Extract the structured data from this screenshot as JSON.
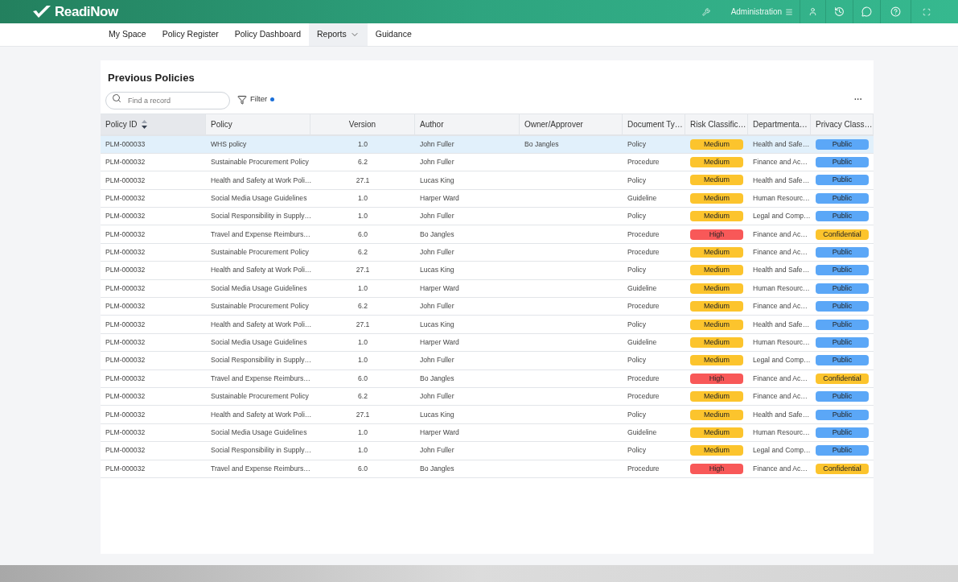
{
  "app": {
    "logo": "ReadiNow",
    "admin_label": "Administration"
  },
  "nav": [
    {
      "label": "My Space",
      "selected": false,
      "dropdown": false
    },
    {
      "label": "Policy Register",
      "selected": false,
      "dropdown": false
    },
    {
      "label": "Policy Dashboard",
      "selected": false,
      "dropdown": false
    },
    {
      "label": "Reports",
      "selected": true,
      "dropdown": true
    },
    {
      "label": "Guidance",
      "selected": false,
      "dropdown": false
    }
  ],
  "report": {
    "title": "Previous Policies",
    "search": {
      "placeholder": "Find a record"
    },
    "filter": {
      "label": "Filter",
      "active": true
    },
    "more": "···"
  },
  "table": {
    "columns": [
      {
        "label": "Policy ID",
        "sorted": true
      },
      {
        "label": "Policy",
        "sorted": false
      },
      {
        "label": "Version",
        "sorted": false
      },
      {
        "label": "Author",
        "sorted": false
      },
      {
        "label": "Owner/Approver",
        "sorted": false
      },
      {
        "label": "Document Ty…",
        "sorted": false
      },
      {
        "label": "Risk Classific…",
        "sorted": false
      },
      {
        "label": "Departmenta…",
        "sorted": false
      },
      {
        "label": "Privacy Class…",
        "sorted": false
      }
    ],
    "rows": [
      {
        "selected": true,
        "id": "PLM-000033",
        "policy": "WHS policy",
        "version": "1.0",
        "author": "John Fuller",
        "owner": "Bo Jangles",
        "doc_type": "Policy",
        "risk": {
          "text": "Medium",
          "color": "#fcc42d"
        },
        "department": "Health and Safe…",
        "privacy": {
          "text": "Public",
          "color": "#5ba7f7"
        }
      },
      {
        "selected": false,
        "id": "PLM-000032",
        "policy": "Sustainable Procurement Policy",
        "version": "6.2",
        "author": "John Fuller",
        "doc_type": "Procedure",
        "risk": {
          "text": "Medium",
          "color": "#fcc42d"
        },
        "department": "Finance and Ac…",
        "privacy": {
          "text": "Public",
          "color": "#5ba7f7"
        }
      },
      {
        "selected": false,
        "id": "PLM-000032",
        "policy": "Health and Safety at Work Poli…",
        "version": "27.1",
        "author": "Lucas King",
        "doc_type": "Policy",
        "risk": {
          "text": "Medium",
          "color": "#fcc42d"
        },
        "department": "Health and Safe…",
        "privacy": {
          "text": "Public",
          "color": "#5ba7f7"
        }
      },
      {
        "selected": false,
        "id": "PLM-000032",
        "policy": "Social Media Usage Guidelines",
        "version": "1.0",
        "author": "Harper Ward",
        "doc_type": "Guideline",
        "risk": {
          "text": "Medium",
          "color": "#fcc42d"
        },
        "department": "Human Resourc…",
        "privacy": {
          "text": "Public",
          "color": "#5ba7f7"
        }
      },
      {
        "selected": false,
        "id": "PLM-000032",
        "policy": "Social Responsibility in Supply…",
        "version": "1.0",
        "author": "John Fuller",
        "doc_type": "Policy",
        "risk": {
          "text": "Medium",
          "color": "#fcc42d"
        },
        "department": "Legal and Comp…",
        "privacy": {
          "text": "Public",
          "color": "#5ba7f7"
        }
      },
      {
        "selected": false,
        "id": "PLM-000032",
        "policy": "Travel and Expense Reimburs…",
        "version": "6.0",
        "author": "Bo Jangles",
        "doc_type": "Procedure",
        "risk": {
          "text": "High",
          "color": "#f85858"
        },
        "department": "Finance and Ac…",
        "privacy": {
          "text": "Confidential",
          "color": "#fcc42d"
        }
      },
      {
        "selected": false,
        "id": "PLM-000032",
        "policy": "Sustainable Procurement Policy",
        "version": "6.2",
        "author": "John Fuller",
        "doc_type": "Procedure",
        "risk": {
          "text": "Medium",
          "color": "#fcc42d"
        },
        "department": "Finance and Ac…",
        "privacy": {
          "text": "Public",
          "color": "#5ba7f7"
        }
      },
      {
        "selected": false,
        "id": "PLM-000032",
        "policy": "Health and Safety at Work Poli…",
        "version": "27.1",
        "author": "Lucas King",
        "doc_type": "Policy",
        "risk": {
          "text": "Medium",
          "color": "#fcc42d"
        },
        "department": "Health and Safe…",
        "privacy": {
          "text": "Public",
          "color": "#5ba7f7"
        }
      },
      {
        "selected": false,
        "id": "PLM-000032",
        "policy": "Social Media Usage Guidelines",
        "version": "1.0",
        "author": "Harper Ward",
        "doc_type": "Guideline",
        "risk": {
          "text": "Medium",
          "color": "#fcc42d"
        },
        "department": "Human Resourc…",
        "privacy": {
          "text": "Public",
          "color": "#5ba7f7"
        }
      },
      {
        "selected": false,
        "id": "PLM-000032",
        "policy": "Sustainable Procurement Policy",
        "version": "6.2",
        "author": "John Fuller",
        "doc_type": "Procedure",
        "risk": {
          "text": "Medium",
          "color": "#fcc42d"
        },
        "department": "Finance and Ac…",
        "privacy": {
          "text": "Public",
          "color": "#5ba7f7"
        }
      },
      {
        "selected": false,
        "id": "PLM-000032",
        "policy": "Health and Safety at Work Poli…",
        "version": "27.1",
        "author": "Lucas King",
        "doc_type": "Policy",
        "risk": {
          "text": "Medium",
          "color": "#fcc42d"
        },
        "department": "Health and Safe…",
        "privacy": {
          "text": "Public",
          "color": "#5ba7f7"
        }
      },
      {
        "selected": false,
        "id": "PLM-000032",
        "policy": "Social Media Usage Guidelines",
        "version": "1.0",
        "author": "Harper Ward",
        "doc_type": "Guideline",
        "risk": {
          "text": "Medium",
          "color": "#fcc42d"
        },
        "department": "Human Resourc…",
        "privacy": {
          "text": "Public",
          "color": "#5ba7f7"
        }
      },
      {
        "selected": false,
        "id": "PLM-000032",
        "policy": "Social Responsibility in Supply…",
        "version": "1.0",
        "author": "John Fuller",
        "doc_type": "Policy",
        "risk": {
          "text": "Medium",
          "color": "#fcc42d"
        },
        "department": "Legal and Comp…",
        "privacy": {
          "text": "Public",
          "color": "#5ba7f7"
        }
      },
      {
        "selected": false,
        "id": "PLM-000032",
        "policy": "Travel and Expense Reimburs…",
        "version": "6.0",
        "author": "Bo Jangles",
        "doc_type": "Procedure",
        "risk": {
          "text": "High",
          "color": "#f85858"
        },
        "department": "Finance and Ac…",
        "privacy": {
          "text": "Confidential",
          "color": "#fcc42d"
        }
      },
      {
        "selected": false,
        "id": "PLM-000032",
        "policy": "Sustainable Procurement Policy",
        "version": "6.2",
        "author": "John Fuller",
        "doc_type": "Procedure",
        "risk": {
          "text": "Medium",
          "color": "#fcc42d"
        },
        "department": "Finance and Ac…",
        "privacy": {
          "text": "Public",
          "color": "#5ba7f7"
        }
      },
      {
        "selected": false,
        "id": "PLM-000032",
        "policy": "Health and Safety at Work Poli…",
        "version": "27.1",
        "author": "Lucas King",
        "doc_type": "Policy",
        "risk": {
          "text": "Medium",
          "color": "#fcc42d"
        },
        "department": "Health and Safe…",
        "privacy": {
          "text": "Public",
          "color": "#5ba7f7"
        }
      },
      {
        "selected": false,
        "id": "PLM-000032",
        "policy": "Social Media Usage Guidelines",
        "version": "1.0",
        "author": "Harper Ward",
        "doc_type": "Guideline",
        "risk": {
          "text": "Medium",
          "color": "#fcc42d"
        },
        "department": "Human Resourc…",
        "privacy": {
          "text": "Public",
          "color": "#5ba7f7"
        }
      },
      {
        "selected": false,
        "id": "PLM-000032",
        "policy": "Social Responsibility in Supply…",
        "version": "1.0",
        "author": "John Fuller",
        "doc_type": "Policy",
        "risk": {
          "text": "Medium",
          "color": "#fcc42d"
        },
        "department": "Legal and Comp…",
        "privacy": {
          "text": "Public",
          "color": "#5ba7f7"
        }
      },
      {
        "selected": false,
        "id": "PLM-000032",
        "policy": "Travel and Expense Reimburs…",
        "version": "6.0",
        "author": "Bo Jangles",
        "doc_type": "Procedure",
        "risk": {
          "text": "High",
          "color": "#f85858"
        },
        "department": "Finance and Ac…",
        "privacy": {
          "text": "Confidential",
          "color": "#fcc42d"
        }
      }
    ]
  }
}
